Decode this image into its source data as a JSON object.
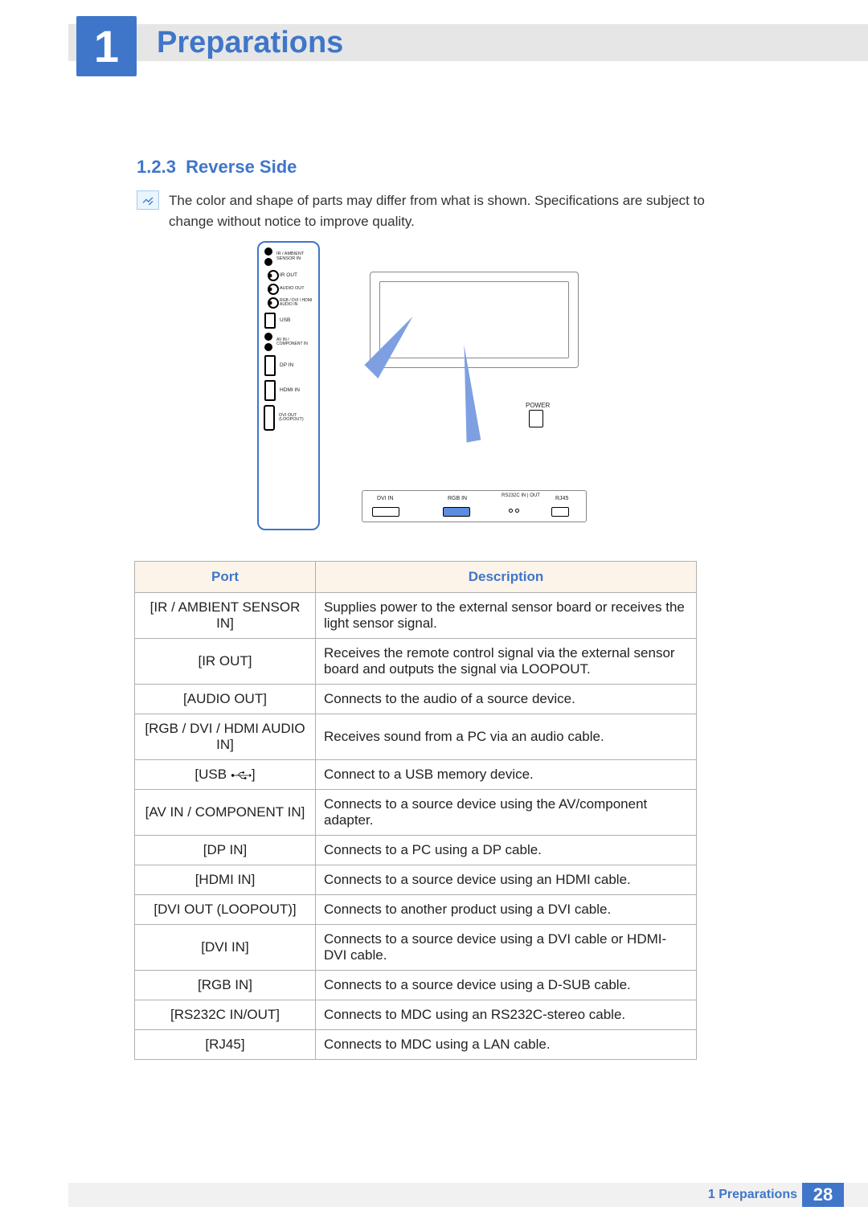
{
  "chapter": {
    "number": "1",
    "title": "Preparations"
  },
  "section": {
    "number": "1.2.3",
    "title": "Reverse Side"
  },
  "note": "The color and shape of parts may differ from what is shown. Specifications are subject to change without notice to improve quality.",
  "diagram": {
    "side_ports": [
      "IR / AMBIENT SENSOR IN",
      "IR OUT",
      "AUDIO OUT",
      "RGB / DVI / HDMI AUDIO IN",
      "USB",
      "AV IN / COMPONENT IN",
      "DP IN",
      "HDMI IN",
      "DVI OUT (LOOPOUT)"
    ],
    "power_label": "POWER",
    "bottom_ports": [
      "DVI IN",
      "RGB IN",
      "RS232C IN | OUT",
      "RJ45"
    ]
  },
  "table": {
    "headers": {
      "port": "Port",
      "description": "Description"
    },
    "rows": [
      {
        "port": "[IR / AMBIENT SENSOR IN]",
        "desc": "Supplies power to the external sensor board or receives the light sensor signal."
      },
      {
        "port": "[IR OUT]",
        "desc": "Receives the remote control signal via the external sensor board and outputs the signal via LOOPOUT."
      },
      {
        "port": "[AUDIO OUT]",
        "desc": "Connects to the audio of a source device."
      },
      {
        "port": "[RGB / DVI / HDMI AUDIO IN]",
        "desc": "Receives sound from a PC via an audio cable."
      },
      {
        "port": "[USB",
        "port_suffix": "]",
        "has_usb_icon": true,
        "desc": "Connect to a USB memory device."
      },
      {
        "port": "[AV IN / COMPONENT IN]",
        "desc": "Connects to a source device using the AV/component adapter."
      },
      {
        "port": "[DP IN]",
        "desc": "Connects to a PC using a DP cable."
      },
      {
        "port": "[HDMI IN]",
        "desc": "Connects to a source device using an HDMI cable."
      },
      {
        "port": "[DVI OUT (LOOPOUT)]",
        "desc": "Connects to another product using a DVI cable."
      },
      {
        "port": "[DVI IN]",
        "desc": "Connects to a source device using a DVI cable or HDMI-DVI cable."
      },
      {
        "port": "[RGB IN]",
        "desc": "Connects to a source device using a D-SUB cable."
      },
      {
        "port": "[RS232C IN/OUT]",
        "desc": "Connects to MDC using an RS232C-stereo cable."
      },
      {
        "port": "[RJ45]",
        "desc": "Connects to MDC using a LAN cable."
      }
    ]
  },
  "footer": {
    "text": "1 Preparations",
    "page": "28"
  }
}
